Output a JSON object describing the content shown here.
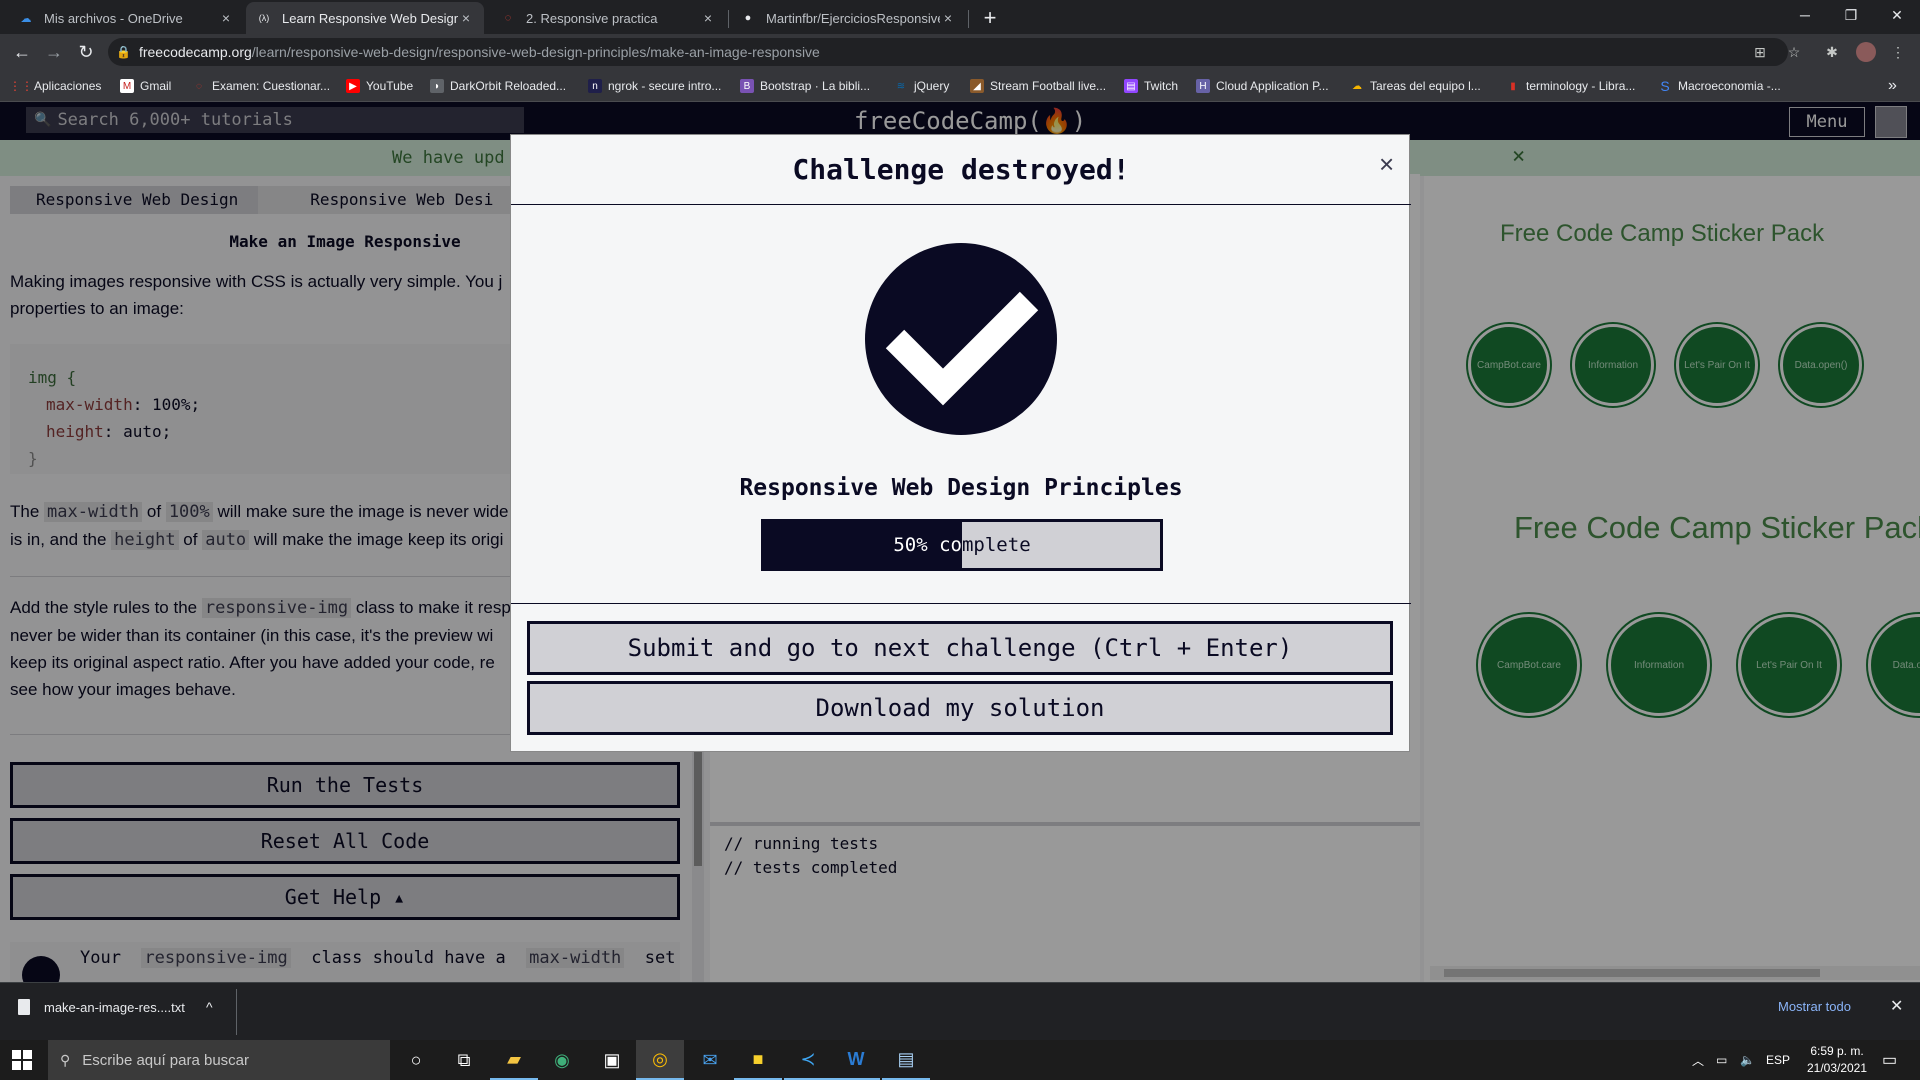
{
  "browser": {
    "tabs": [
      {
        "title": "Mis archivos - OneDrive",
        "active": false,
        "favicon": "onedrive-icon",
        "close": "×"
      },
      {
        "title": "Learn Responsive Web Design Pr",
        "active": true,
        "favicon": "freecodecamp-icon",
        "close": "×"
      },
      {
        "title": "2. Responsive practica",
        "active": false,
        "favicon": "loading-icon",
        "close": "×"
      },
      {
        "title": "Martinfbr/EjerciciosResponsive",
        "active": false,
        "favicon": "github-icon",
        "close": "×"
      }
    ],
    "new_tab": "+",
    "window_controls": {
      "minimize": "─",
      "restore": "❐",
      "close": "✕"
    },
    "address": {
      "host": "freecodecamp.org",
      "path": "/learn/responsive-web-design/responsive-web-design-principles/make-an-image-responsive"
    },
    "bookmarks": [
      {
        "label": "Aplicaciones",
        "icon": "apps-icon",
        "color": "#ea4335"
      },
      {
        "label": "Gmail",
        "icon": "gmail-icon",
        "color": "#c5221f"
      },
      {
        "label": "Examen: Cuestionar...",
        "icon": "moodle-icon",
        "color": "#d93025"
      },
      {
        "label": "YouTube",
        "icon": "youtube-icon",
        "color": "#ff0000"
      },
      {
        "label": "DarkOrbit Reloaded...",
        "icon": "darkorbit-icon",
        "color": "#5f6368"
      },
      {
        "label": "ngrok - secure intro...",
        "icon": "ngrok-icon",
        "color": "#1f1f4a"
      },
      {
        "label": "Bootstrap · La bibli...",
        "icon": "bootstrap-icon",
        "color": "#7952b3"
      },
      {
        "label": "jQuery",
        "icon": "jquery-icon",
        "color": "#0769ad"
      },
      {
        "label": "Stream Football live...",
        "icon": "football-icon",
        "color": "#8a5a2b"
      },
      {
        "label": "Twitch",
        "icon": "twitch-icon",
        "color": "#9146ff"
      },
      {
        "label": "Cloud Application P...",
        "icon": "heroku-icon",
        "color": "#6762a6"
      },
      {
        "label": "Tareas del equipo l...",
        "icon": "tasks-icon",
        "color": "#f4b400"
      },
      {
        "label": "terminology - Libra...",
        "icon": "library-icon",
        "color": "#d93025"
      },
      {
        "label": "Macroeconomia -...",
        "icon": "sharepoint-icon",
        "color": "#4285f4"
      }
    ],
    "bookmarks_more": "»"
  },
  "fcc": {
    "search_placeholder": "Search 6,000+ tutorials",
    "logo": "freeCodeCamp(🔥)",
    "menu": "Menu",
    "banner": "We have upd",
    "banner_close": "×",
    "breadcrumb": [
      "Responsive Web Design",
      "Responsive Web Desi"
    ],
    "lesson_title": "Make an Image Responsive",
    "intro_1": "Making images responsive with CSS is actually very simple. You j",
    "intro_2": "properties to an image:",
    "code_lines": [
      "img {",
      "max-width",
      ": 100%;",
      "height",
      ": auto;",
      "}"
    ],
    "para_the": "The",
    "para_maxwidth": "max-width",
    "para_of": "of",
    "para_100": "100%",
    "para_rest1": "will make sure the image is never wide",
    "para_isin": "is in, and the",
    "para_height": "height",
    "para_of2": "of",
    "para_auto": "auto",
    "para_rest2": "will make the image keep its origi",
    "task_1a": "Add the style rules to the",
    "task_class": "responsive-img",
    "task_1b": "class to make it resp",
    "task_2": "never be wider than its container (in this case, it's the preview wi",
    "task_3": "keep its original aspect ratio. After you have added your code, re",
    "task_4": "see how your images behave.",
    "buttons": {
      "run": "Run the Tests",
      "reset": "Reset All Code",
      "help": "Get Help ▴"
    },
    "test_1": "Your",
    "test_class": "responsive-img",
    "test_2": "class should have a",
    "test_prop": "max-width",
    "test_3": "set",
    "console": [
      "// running tests",
      "// tests completed"
    ],
    "preview_title": "Free Code Camp Sticker Pack",
    "sticker_labels": [
      "CampBot.care",
      "Information",
      "Let's Pair On It",
      "Data.open()"
    ]
  },
  "modal": {
    "title": "Challenge destroyed!",
    "close": "×",
    "superblock": "Responsive Web Design Principles",
    "progress_percent": 50,
    "progress_label": "50% complete",
    "submit": "Submit and go to next challenge (Ctrl + Enter)",
    "download": "Download my solution"
  },
  "downloads": {
    "file": "make-an-image-res....txt",
    "show_all": "Mostrar todo",
    "close": "✕",
    "chevron": "^"
  },
  "taskbar": {
    "search_placeholder": "Escribe aquí para buscar",
    "apps": [
      "cortana-icon",
      "task-view-icon",
      "file-explorer-icon",
      "edge-icon",
      "store-icon",
      "chrome-icon",
      "mail-icon",
      "sticky-notes-icon",
      "vscode-icon",
      "word-icon",
      "notepad-icon"
    ],
    "lang": "ESP",
    "time": "6:59 p. m.",
    "date": "21/03/2021"
  },
  "colors": {
    "fcc_dark": "#0a0a23",
    "fcc_gray": "#d0d0d5",
    "sticker_green": "#1b7a3a",
    "link_blue": "#8ab4f8"
  }
}
